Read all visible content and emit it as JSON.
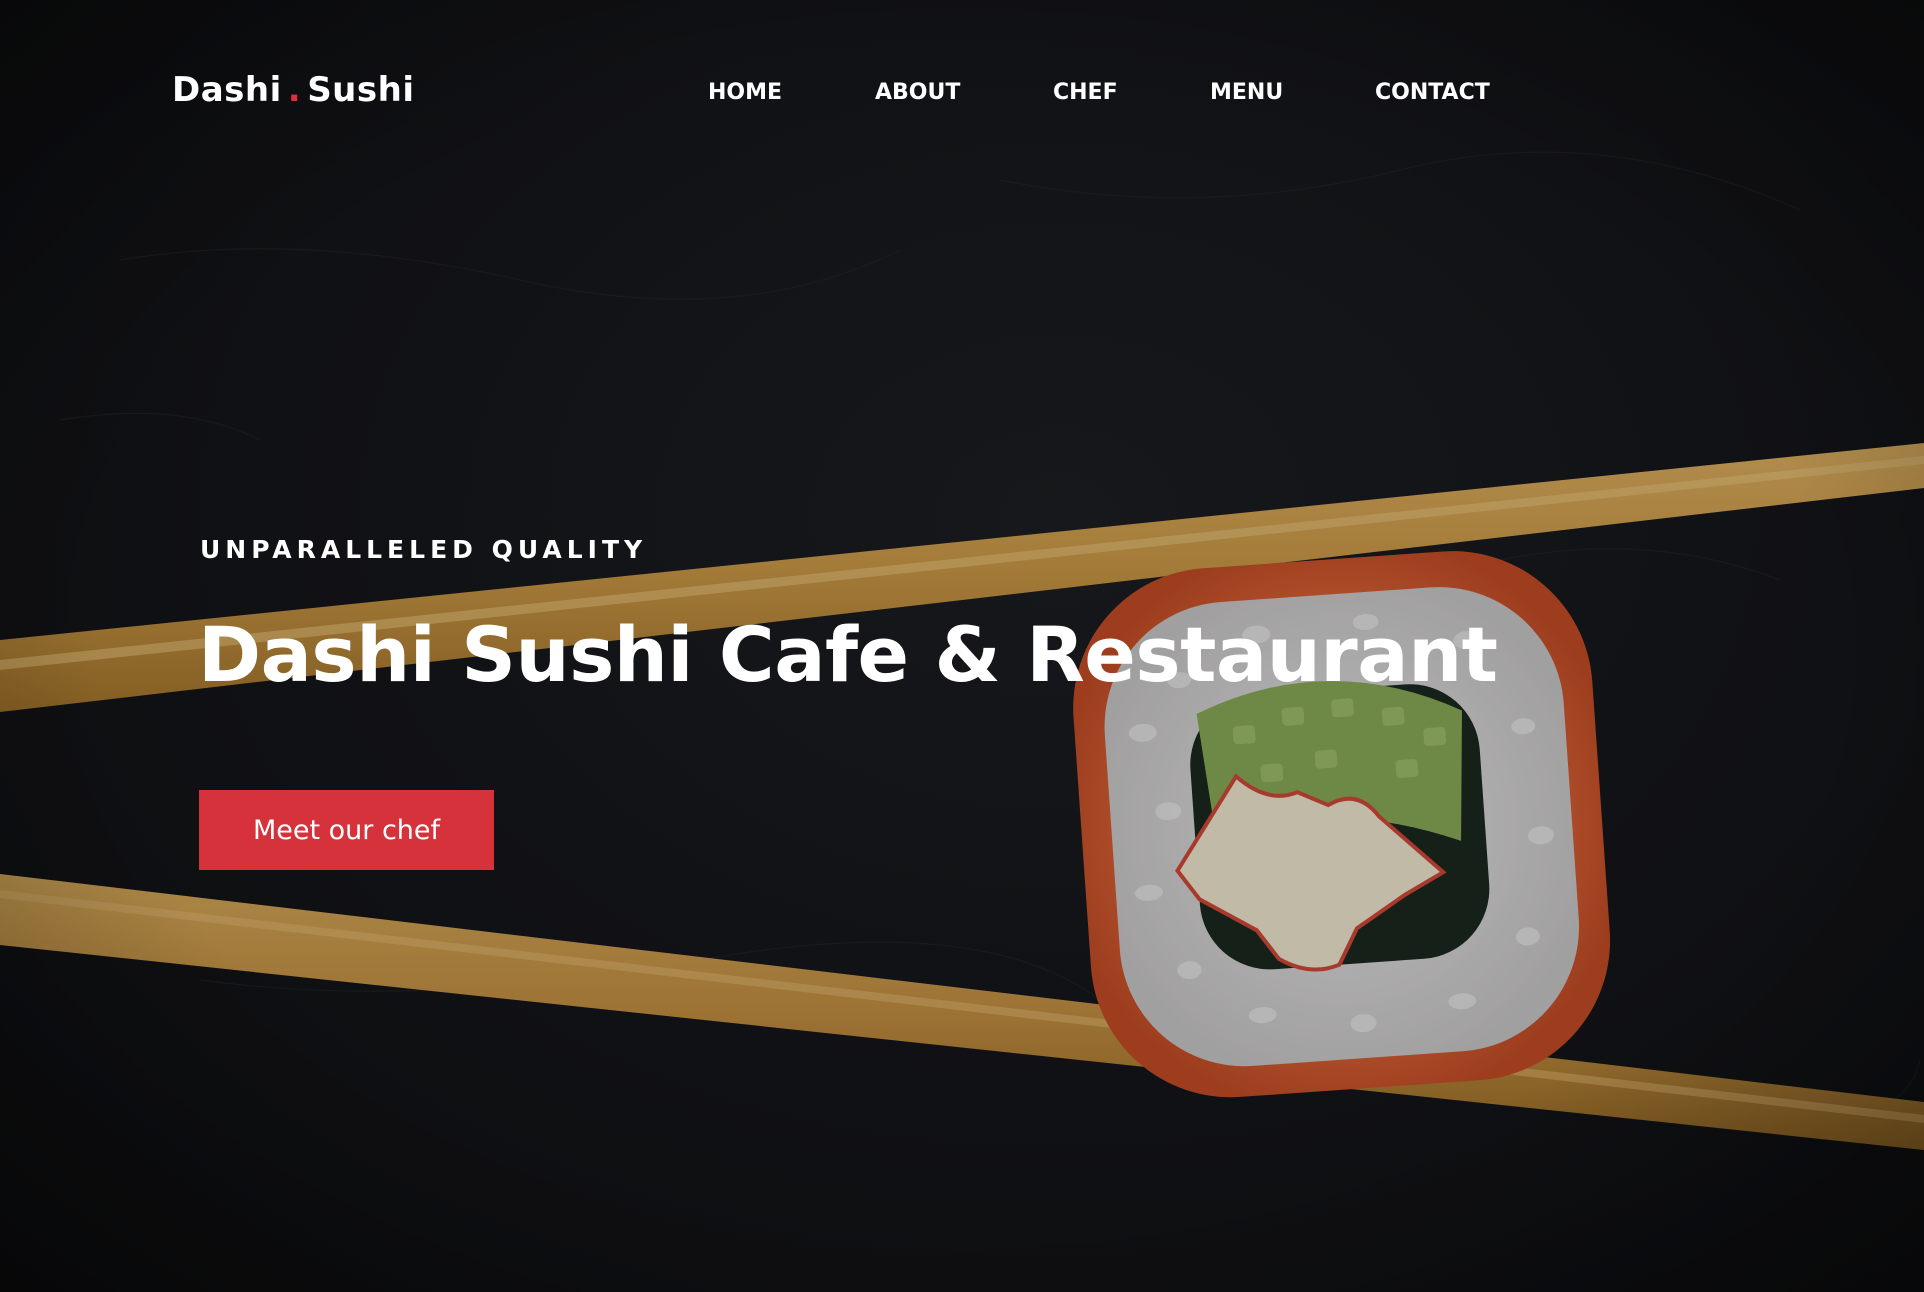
{
  "brand": {
    "name_part1": "Dashi",
    "separator": ".",
    "name_part2": "Sushi",
    "accent_color": "#d6323b"
  },
  "nav": {
    "items": [
      {
        "label": "HOME"
      },
      {
        "label": "ABOUT"
      },
      {
        "label": "CHEF"
      },
      {
        "label": "MENU"
      },
      {
        "label": "CONTACT"
      }
    ]
  },
  "hero": {
    "kicker": "UNPARALLELED QUALITY",
    "title": "Dashi Sushi Cafe & Restaurant",
    "cta_label": "Meet our chef",
    "background_image": "chopsticks holding a sushi roll on a dark surface"
  }
}
